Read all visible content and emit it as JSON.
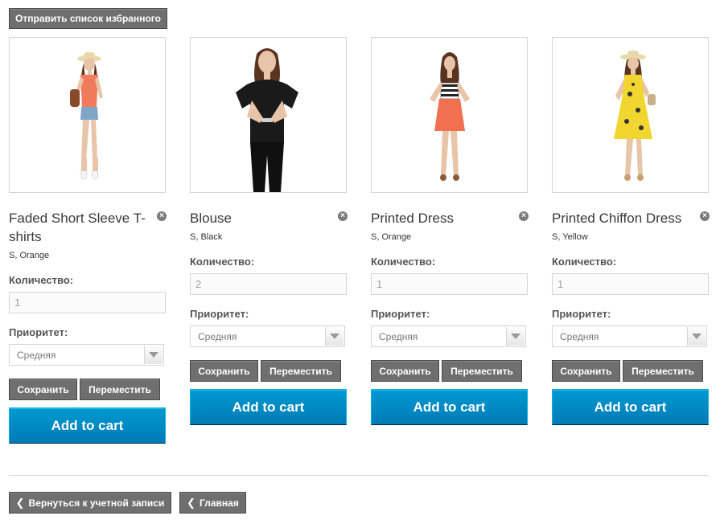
{
  "header": {
    "send_wishlist_label": "Отправить список избранного"
  },
  "products": [
    {
      "title": "Faded Short Sleeve T-shirts",
      "attributes": "S, Orange",
      "quantity_label": "Количество:",
      "quantity_value": "1",
      "priority_label": "Приоритет:",
      "priority_value": "Средняя",
      "save_label": "Сохранить",
      "move_label": "Переместить",
      "add_to_cart_label": "Add to cart",
      "image_icon": "woman-orange-top-denim-shorts-hat"
    },
    {
      "title": "Blouse",
      "attributes": "S, Black",
      "quantity_label": "Количество:",
      "quantity_value": "2",
      "priority_label": "Приоритет:",
      "priority_value": "Средняя",
      "save_label": "Сохранить",
      "move_label": "Переместить",
      "add_to_cart_label": "Add to cart",
      "image_icon": "woman-black-blouse"
    },
    {
      "title": "Printed Dress",
      "attributes": "S, Orange",
      "quantity_label": "Количество:",
      "quantity_value": "1",
      "priority_label": "Приоритет:",
      "priority_value": "Средняя",
      "save_label": "Сохранить",
      "move_label": "Переместить",
      "add_to_cart_label": "Add to cart",
      "image_icon": "woman-striped-top-orange-skirt"
    },
    {
      "title": "Printed Chiffon Dress",
      "attributes": "S, Yellow",
      "quantity_label": "Количество:",
      "quantity_value": "1",
      "priority_label": "Приоритет:",
      "priority_value": "Средняя",
      "save_label": "Сохранить",
      "move_label": "Переместить",
      "add_to_cart_label": "Add to cart",
      "image_icon": "woman-yellow-chiffon-dress-hat"
    }
  ],
  "footer": {
    "back_label": "Вернуться к учетной записи",
    "home_label": "Главная"
  },
  "colors": {
    "dark_button": "#6f6f6f",
    "cart_button": "#0088c4",
    "border": "#d6d4d4"
  }
}
